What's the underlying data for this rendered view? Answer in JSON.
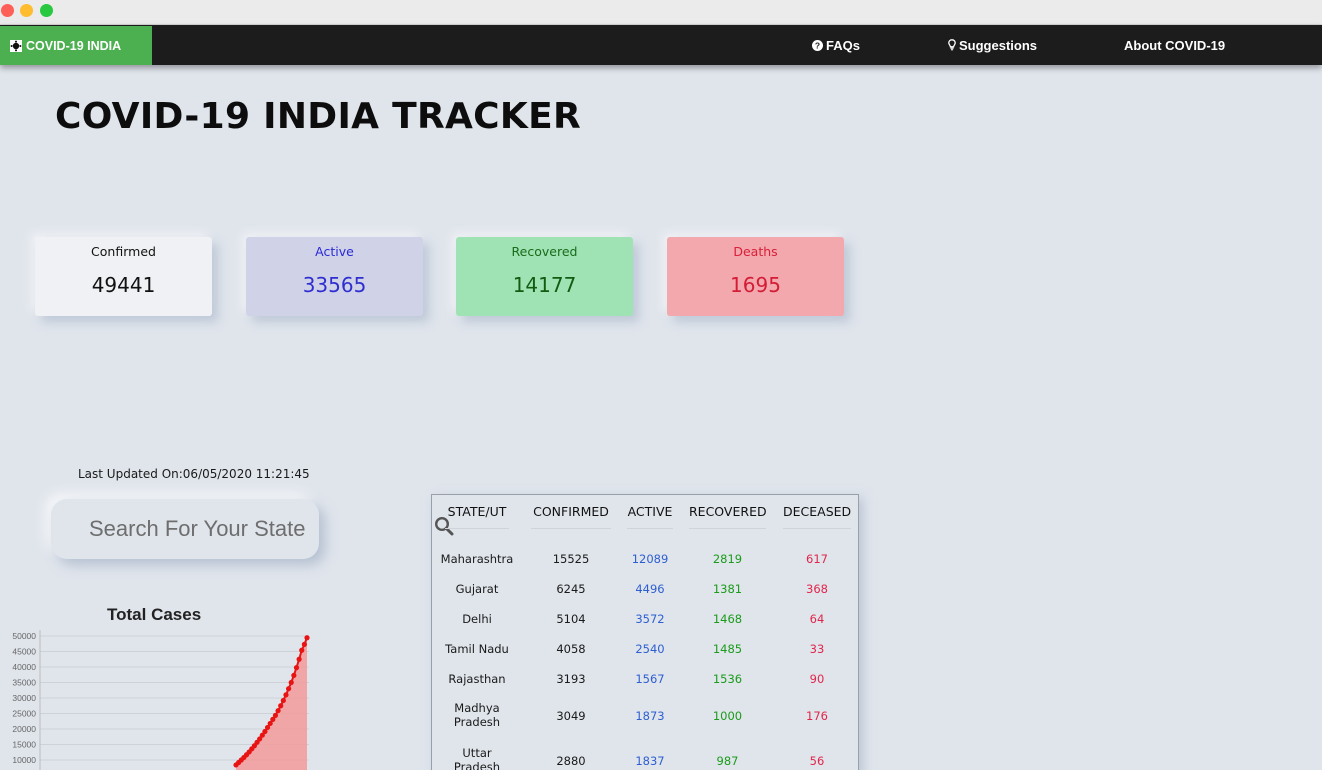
{
  "nav": {
    "brand": "COVID-19 INDIA",
    "faq": "FAQs",
    "suggestions": "Suggestions",
    "about": "About COVID-19"
  },
  "page_title": "COVID-19 INDIA TRACKER",
  "stats": {
    "confirmed": {
      "label": "Confirmed",
      "value": "49441"
    },
    "active": {
      "label": "Active",
      "value": "33565"
    },
    "recovered": {
      "label": "Recovered",
      "value": "14177"
    },
    "deaths": {
      "label": "Deaths",
      "value": "1695"
    }
  },
  "last_updated": "Last Updated On:06/05/2020 11:21:45",
  "search": {
    "placeholder": "Search For Your State"
  },
  "table": {
    "headers": [
      "STATE/UT",
      "CONFIRMED",
      "ACTIVE",
      "RECOVERED",
      "DECEASED"
    ],
    "rows": [
      {
        "state": "Maharashtra",
        "confirmed": "15525",
        "active": "12089",
        "recovered": "2819",
        "deceased": "617"
      },
      {
        "state": "Gujarat",
        "confirmed": "6245",
        "active": "4496",
        "recovered": "1381",
        "deceased": "368"
      },
      {
        "state": "Delhi",
        "confirmed": "5104",
        "active": "3572",
        "recovered": "1468",
        "deceased": "64"
      },
      {
        "state": "Tamil Nadu",
        "confirmed": "4058",
        "active": "2540",
        "recovered": "1485",
        "deceased": "33"
      },
      {
        "state": "Rajasthan",
        "confirmed": "3193",
        "active": "1567",
        "recovered": "1536",
        "deceased": "90"
      },
      {
        "state": "Madhya Pradesh",
        "confirmed": "3049",
        "active": "1873",
        "recovered": "1000",
        "deceased": "176"
      },
      {
        "state": "Uttar Pradesh",
        "confirmed": "2880",
        "active": "1837",
        "recovered": "987",
        "deceased": "56"
      }
    ]
  },
  "colors": {
    "brand_green": "#4caf50",
    "navbar": "#1c1c1c",
    "background": "#e0e5ec",
    "active_blue": "#2d5fd0",
    "recovered_green": "#1a9b1a",
    "deaths_red": "#e0264a"
  },
  "chart_data": {
    "type": "area",
    "title": "Total Cases",
    "xlabel": "",
    "ylabel": "",
    "ylim": [
      0,
      50000
    ],
    "yticks": [
      10000,
      15000,
      20000,
      25000,
      30000,
      35000,
      40000,
      45000,
      50000
    ],
    "grid": true,
    "series": [
      {
        "values": [
          8400,
          9200,
          10000,
          10800,
          11700,
          12600,
          13600,
          14600,
          15700,
          16800,
          18000,
          19200,
          20500,
          21800,
          23100,
          24400,
          25900,
          27500,
          29200,
          31000,
          33000,
          35000,
          37300,
          39800,
          42500,
          45400,
          47300,
          49441
        ]
      }
    ]
  }
}
